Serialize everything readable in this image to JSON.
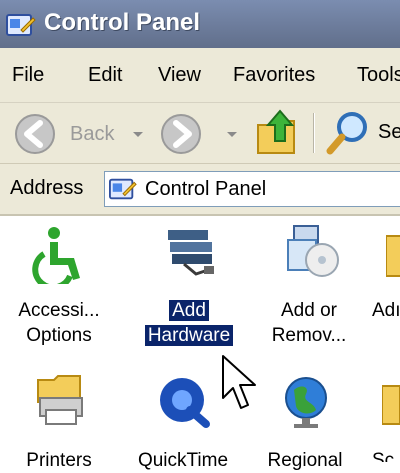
{
  "window": {
    "title": "Control Panel"
  },
  "menu": [
    "File",
    "Edit",
    "View",
    "Favorites",
    "Tools"
  ],
  "toolbar": {
    "back_label": "Back",
    "search_label": "Se"
  },
  "address": {
    "label": "Address",
    "value": "Control Panel"
  },
  "items": [
    {
      "line1": "Accessi...",
      "line2": "Options",
      "icon": "accessibility-icon"
    },
    {
      "line1": "Add",
      "line2": "Hardware",
      "icon": "add-hardware-icon",
      "selected": true
    },
    {
      "line1": "Add or",
      "line2": "Remov...",
      "icon": "add-remove-programs-icon"
    },
    {
      "line1": "Adı",
      "line2": "",
      "icon": "administrative-tools-icon"
    },
    {
      "line1": "Printers",
      "line2": "",
      "icon": "printers-icon"
    },
    {
      "line1": "QuickTime",
      "line2": "",
      "icon": "quicktime-icon"
    },
    {
      "line1": "Regional",
      "line2": "",
      "icon": "regional-icon"
    },
    {
      "line1": "Sc",
      "line2": "",
      "icon": "scheduled-icon"
    }
  ],
  "colors": {
    "selection": "#0a246a",
    "titlebar": "#6f7f9f",
    "chrome": "#ece9d8"
  }
}
